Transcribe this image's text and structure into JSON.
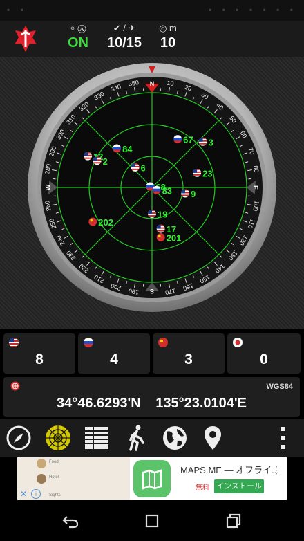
{
  "topbar": {
    "status": {
      "label": "⌖ Ⓐ",
      "value": "ON",
      "color": "#3ddc3d"
    },
    "satellites": {
      "label": "✔ / ✈",
      "value": "10/15"
    },
    "accuracy": {
      "label": "◎ m",
      "value": "10"
    }
  },
  "compass": {
    "cardinals": [
      "N",
      "E",
      "S",
      "W"
    ],
    "ticks": [
      "10",
      "20",
      "30",
      "40",
      "50",
      "60",
      "70",
      "80",
      "100",
      "110",
      "120",
      "130",
      "140",
      "150",
      "160",
      "170",
      "190",
      "200",
      "210",
      "220",
      "230",
      "240",
      "250",
      "260",
      "280",
      "290",
      "300",
      "310",
      "320",
      "330",
      "340",
      "350"
    ],
    "satellites": [
      {
        "id": "84",
        "flag": "ru",
        "az": 318,
        "el": 40
      },
      {
        "id": "67",
        "flag": "ru",
        "az": 28,
        "el": 38
      },
      {
        "id": "3",
        "flag": "us",
        "az": 48,
        "el": 25
      },
      {
        "id": "12",
        "flag": "us",
        "az": 296,
        "el": 22
      },
      {
        "id": "2",
        "flag": "us",
        "az": 296,
        "el": 32
      },
      {
        "id": "6",
        "flag": "us",
        "az": 320,
        "el": 65
      },
      {
        "id": "68",
        "flag": "ru",
        "az": 300,
        "el": 88
      },
      {
        "id": "83",
        "flag": "ru",
        "az": 120,
        "el": 85
      },
      {
        "id": "23",
        "flag": "us",
        "az": 72,
        "el": 45
      },
      {
        "id": "9",
        "flag": "us",
        "az": 100,
        "el": 58
      },
      {
        "id": "19",
        "flag": "us",
        "az": 180,
        "el": 65
      },
      {
        "id": "17",
        "flag": "us",
        "az": 168,
        "el": 50
      },
      {
        "id": "202",
        "flag": "cn",
        "az": 240,
        "el": 25
      },
      {
        "id": "201",
        "flag": "cn",
        "az": 170,
        "el": 42
      }
    ]
  },
  "constellations": [
    {
      "name": "us-flag",
      "count": "8"
    },
    {
      "name": "ru-flag",
      "count": "4"
    },
    {
      "name": "cn-flag",
      "count": "3"
    },
    {
      "name": "jp-flag",
      "count": "0"
    }
  ],
  "position": {
    "datum": "WGS84",
    "coords": "34°46.6293'N 135°23.0104'E"
  },
  "toolbar": [
    "compass-icon",
    "radar-icon",
    "list-icon",
    "walk-icon",
    "globe-icon",
    "map-pin-icon",
    "more-vertical-icon"
  ],
  "ad": {
    "title": "MAPS.ME — オフライ...",
    "free": "無料",
    "install": "インストール",
    "map_labels": [
      "Food",
      "Hotel",
      "Sights"
    ],
    "close": "✕",
    "info": "i",
    "more": "⋮"
  },
  "colors": {
    "radar": "#22cc22",
    "label": "#33ee33",
    "bezel": "#c9c9c9"
  }
}
